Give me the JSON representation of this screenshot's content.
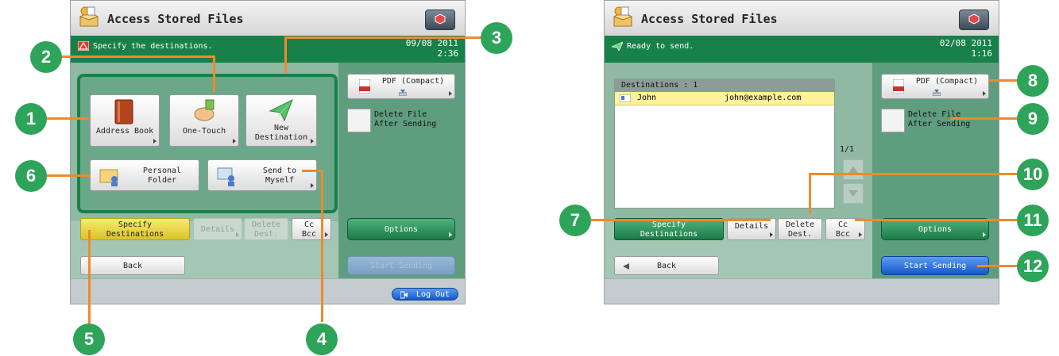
{
  "left_screen": {
    "title": "Access Stored Files",
    "status_message": "Specify the destinations.",
    "date": "09/08 2011",
    "time": "2:36",
    "tiles": {
      "address_book": "Address Book",
      "one_touch": "One-Touch",
      "new_destination_l1": "New",
      "new_destination_l2": "Destination",
      "personal_folder_l1": "Personal",
      "personal_folder_l2": "Folder",
      "send_to_myself_l1": "Send to",
      "send_to_myself_l2": "Myself"
    },
    "tabs": {
      "specify_l1": "Specify",
      "specify_l2": "Destinations",
      "details": "Details",
      "delete_l1": "Delete",
      "delete_l2": "Dest.",
      "cc_l1": "Cc",
      "cc_l2": "Bcc"
    },
    "back": "Back",
    "pdf_label": "PDF (Compact)",
    "delete_file_l1": "Delete File",
    "delete_file_l2": "After Sending",
    "options": "Options",
    "start_sending": "Start Sending",
    "logout": "Log Out"
  },
  "right_screen": {
    "title": "Access Stored Files",
    "status_message": "Ready to send.",
    "date": "02/08 2011",
    "time": "1:16",
    "destinations_header": "Destinations  : 1",
    "destinations": [
      {
        "name": "John",
        "email": "john@example.com"
      }
    ],
    "page_indicator": "1/1",
    "tabs": {
      "specify_l1": "Specify",
      "specify_l2": "Destinations",
      "details": "Details",
      "delete_l1": "Delete",
      "delete_l2": "Dest.",
      "cc_l1": "Cc",
      "cc_l2": "Bcc"
    },
    "back": "Back",
    "pdf_label": "PDF (Compact)",
    "delete_file_l1": "Delete File",
    "delete_file_l2": "After Sending",
    "options": "Options",
    "start_sending": "Start Sending"
  },
  "callouts": [
    "1",
    "2",
    "3",
    "4",
    "5",
    "6",
    "7",
    "8",
    "9",
    "10",
    "11",
    "12"
  ],
  "colors": {
    "status_green": "#18814a",
    "callout_green": "#2ea35a",
    "leader_orange": "#ef8a2a",
    "start_blue": "#1659c9"
  }
}
